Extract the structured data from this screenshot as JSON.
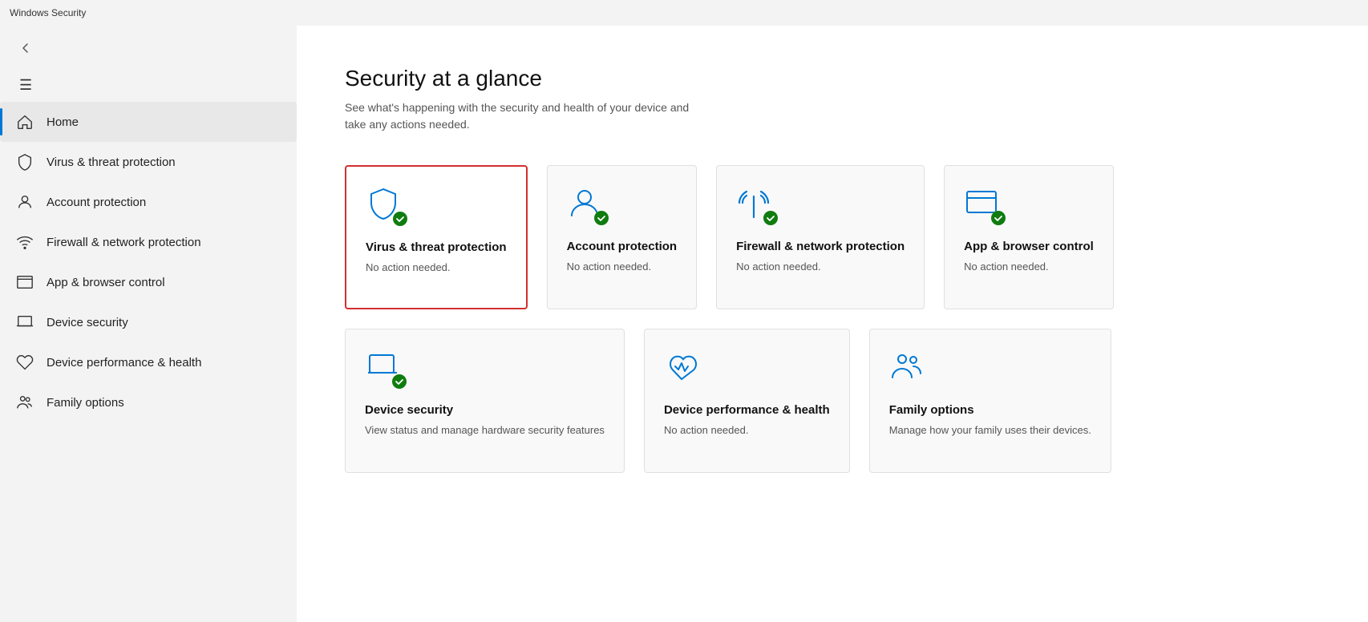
{
  "titleBar": {
    "title": "Windows Security"
  },
  "sidebar": {
    "hamburger": "☰",
    "back": "←",
    "items": [
      {
        "id": "home",
        "label": "Home",
        "icon": "home",
        "active": true
      },
      {
        "id": "virus",
        "label": "Virus & threat protection",
        "icon": "shield"
      },
      {
        "id": "account",
        "label": "Account protection",
        "icon": "person"
      },
      {
        "id": "firewall",
        "label": "Firewall & network protection",
        "icon": "wifi"
      },
      {
        "id": "app-browser",
        "label": "App & browser control",
        "icon": "browser"
      },
      {
        "id": "device-security",
        "label": "Device security",
        "icon": "laptop"
      },
      {
        "id": "device-health",
        "label": "Device performance & health",
        "icon": "heart"
      },
      {
        "id": "family",
        "label": "Family options",
        "icon": "family"
      }
    ]
  },
  "main": {
    "title": "Security at a glance",
    "subtitle": "See what's happening with the security and health of your device and take any actions needed.",
    "cards": [
      {
        "id": "virus-card",
        "title": "Virus & threat protection",
        "desc": "No action needed.",
        "selected": true,
        "hasCheck": true
      },
      {
        "id": "account-card",
        "title": "Account protection",
        "desc": "No action needed.",
        "selected": false,
        "hasCheck": true
      },
      {
        "id": "firewall-card",
        "title": "Firewall & network protection",
        "desc": "No action needed.",
        "selected": false,
        "hasCheck": true
      },
      {
        "id": "app-browser-card",
        "title": "App & browser control",
        "desc": "No action needed.",
        "selected": false,
        "hasCheck": true
      },
      {
        "id": "device-security-card",
        "title": "Device security",
        "desc": "View status and manage hardware security features",
        "selected": false,
        "hasCheck": true
      },
      {
        "id": "device-health-card",
        "title": "Device performance & health",
        "desc": "No action needed.",
        "selected": false,
        "hasCheck": false
      },
      {
        "id": "family-card",
        "title": "Family options",
        "desc": "Manage how your family uses their devices.",
        "selected": false,
        "hasCheck": false
      }
    ]
  }
}
